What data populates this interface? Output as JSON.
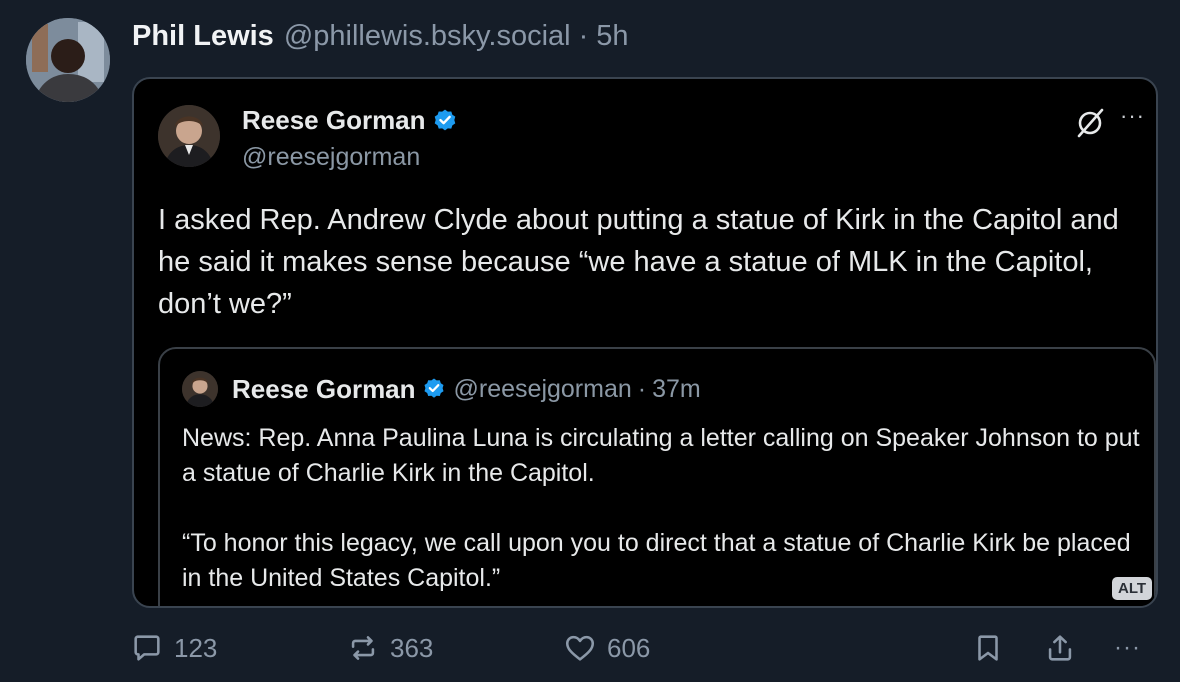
{
  "post": {
    "author_name": "Phil Lewis",
    "author_handle": "@phillewis.bsky.social",
    "separator": "·",
    "time": "5h",
    "avatar_icon": "user-avatar"
  },
  "embed": {
    "author_name": "Reese Gorman",
    "author_handle": "@reesejgorman",
    "verified_icon": "verified-badge-icon",
    "brand_icon": "x-logo-icon",
    "more_label": "···",
    "text": "I asked Rep. Andrew Clyde about putting a statue of Kirk in the Capitol and he said it makes sense because “we have a statue of MLK in the Capitol, don’t we?”",
    "quote": {
      "author_name": "Reese Gorman",
      "author_handle": "@reesejgorman",
      "separator": "·",
      "time": "37m",
      "paragraphs": [
        "News: Rep. Anna Paulina Luna is circulating a letter calling on Speaker Johnson to put a statue of Charlie Kirk in the Capitol.",
        "“To honor this legacy, we call upon you to direct that a statue of Charlie Kirk be placed in the United States Capitol.”"
      ]
    },
    "alt_badge": "ALT"
  },
  "actions": {
    "replies": "123",
    "reposts": "363",
    "likes": "606",
    "more_label": "···"
  },
  "colors": {
    "background": "#151d28",
    "text_primary": "#f1f3f5",
    "text_secondary": "#8b98a8",
    "verified": "#1d9bf0"
  }
}
